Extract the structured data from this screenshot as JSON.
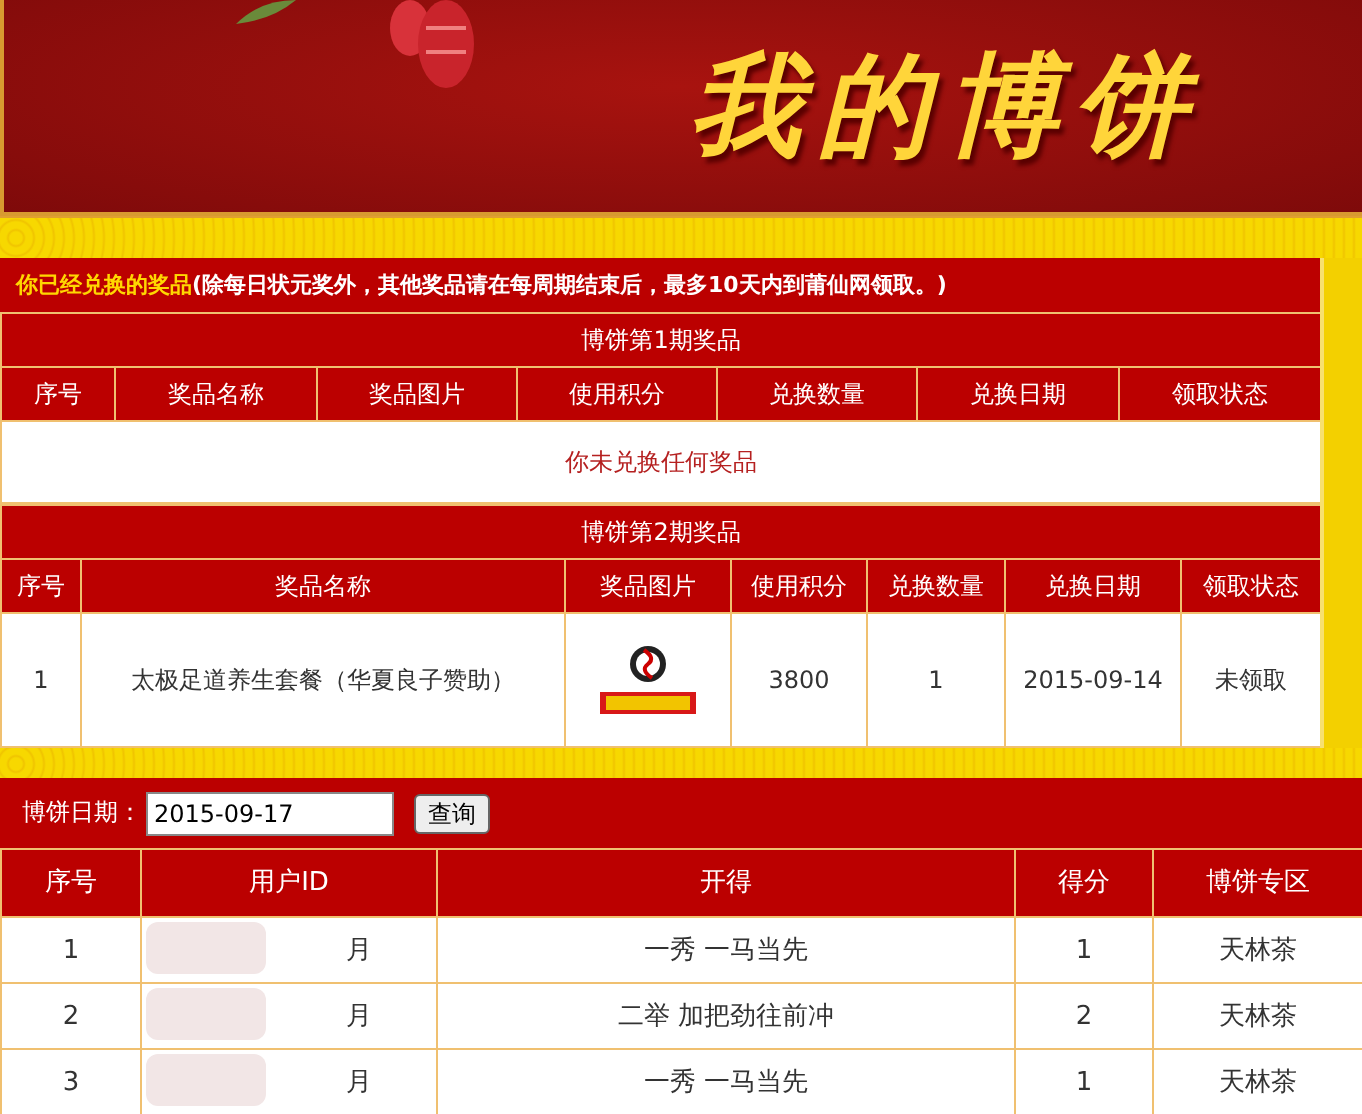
{
  "banner": {
    "title": "我的博饼"
  },
  "redeemed": {
    "notice_lead": "你已经兑换的奖品",
    "notice_rest": "(除每日状元奖外，其他奖品请在每周期结束后，最多10天内到莆仙网领取。)",
    "periods": [
      {
        "title": "博饼第1期奖品",
        "columns": [
          "序号",
          "奖品名称",
          "奖品图片",
          "使用积分",
          "兑换数量",
          "兑换日期",
          "领取状态"
        ],
        "empty_message": "你未兑换任何奖品"
      },
      {
        "title": "博饼第2期奖品",
        "columns": [
          "序号",
          "奖品名称",
          "奖品图片",
          "使用积分",
          "兑换数量",
          "兑换日期",
          "领取状态"
        ],
        "rows": [
          {
            "index": "1",
            "name": "太极足道养生套餐（华夏良子赞助）",
            "points": "3800",
            "quantity": "1",
            "date": "2015-09-14",
            "status": "未领取"
          }
        ]
      }
    ]
  },
  "query": {
    "label": "博饼日期：",
    "date_value": "2015-09-17",
    "button": "查询"
  },
  "results": {
    "columns": [
      "序号",
      "用户ID",
      "开得",
      "得分",
      "博饼专区"
    ],
    "rows": [
      {
        "index": "1",
        "user": "月",
        "result": "一秀 一马当先",
        "score": "1",
        "zone": "天林茶"
      },
      {
        "index": "2",
        "user": "月",
        "result": "二举 加把劲往前冲",
        "score": "2",
        "zone": "天林茶"
      },
      {
        "index": "3",
        "user": "月",
        "result": "一秀 一马当先",
        "score": "1",
        "zone": "天林茶"
      }
    ]
  }
}
